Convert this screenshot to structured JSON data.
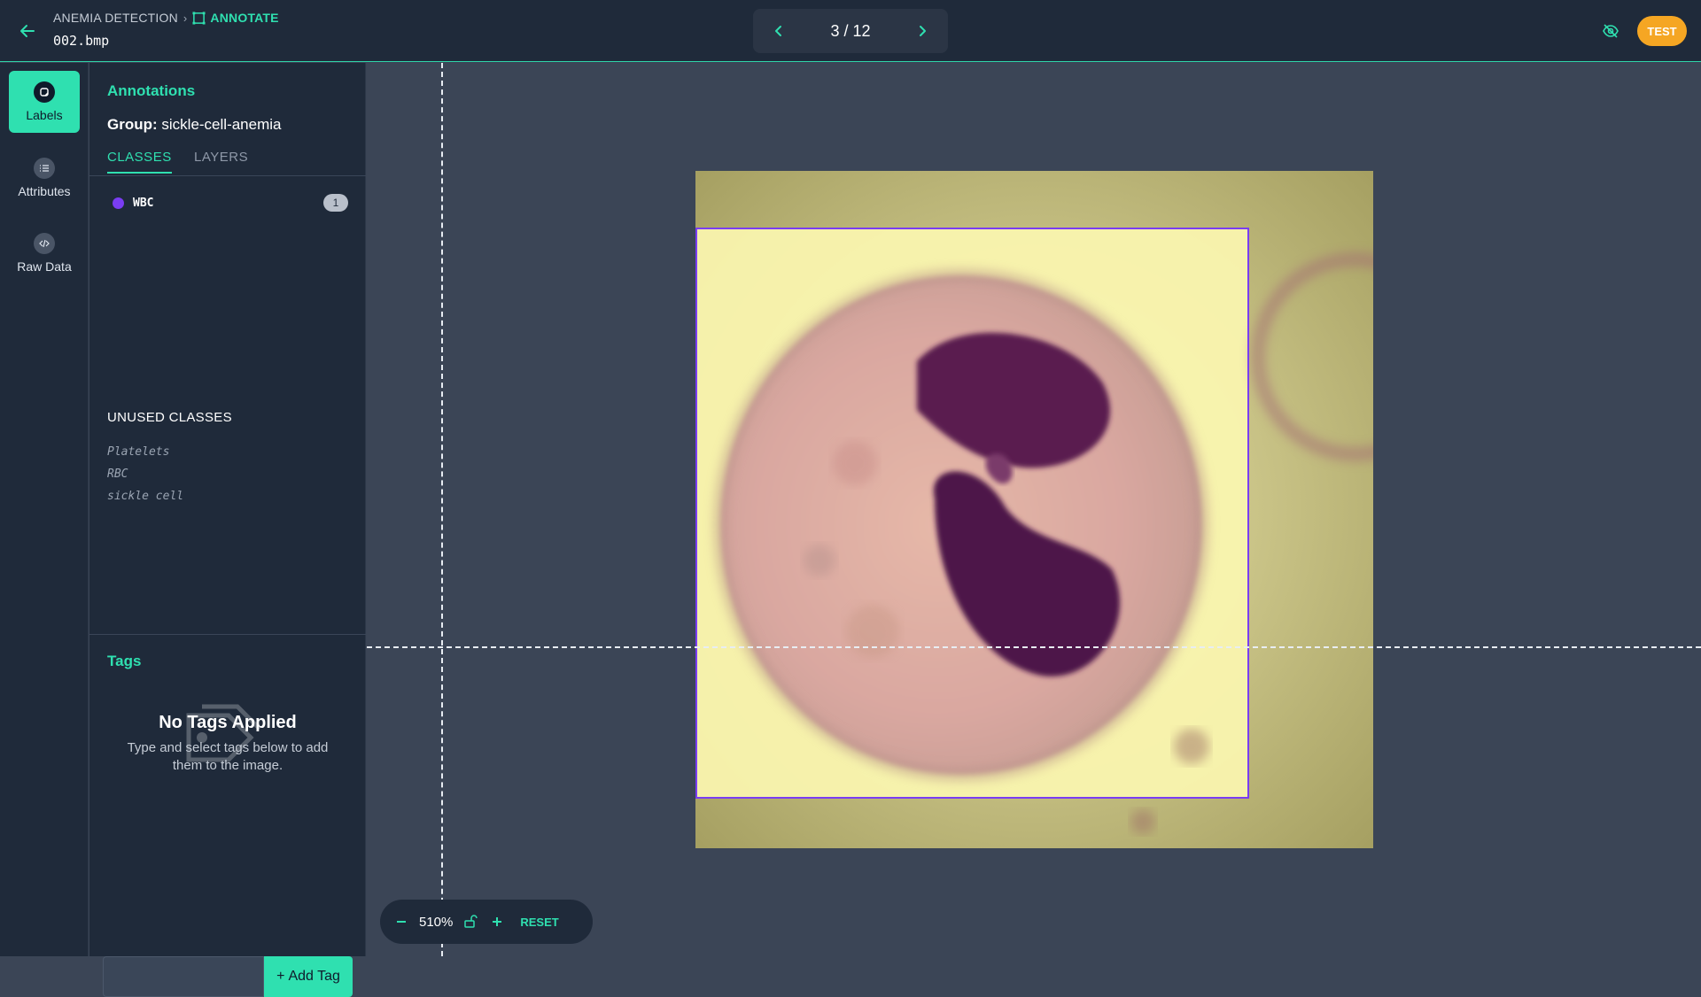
{
  "header": {
    "breadcrumb_project": "ANEMIA DETECTION",
    "breadcrumb_current": "ANNOTATE",
    "filename": "002.bmp",
    "pager_count": "3 / 12",
    "user_initials": "TEST"
  },
  "rail": {
    "items": [
      {
        "label": "Labels",
        "icon": "label-icon",
        "active": true
      },
      {
        "label": "Attributes",
        "icon": "list-icon",
        "active": false
      },
      {
        "label": "Raw Data",
        "icon": "code-icon",
        "active": false
      }
    ]
  },
  "panel": {
    "title": "Annotations",
    "group_label": "Group:",
    "group_value": "sickle-cell-anemia",
    "tabs": [
      "CLASSES",
      "LAYERS"
    ],
    "classes": [
      {
        "name": "WBC",
        "count": "1",
        "color": "#7a3df2"
      }
    ],
    "unused_title": "UNUSED CLASSES",
    "unused": [
      "Platelets",
      "RBC",
      "sickle cell"
    ]
  },
  "tags": {
    "title": "Tags",
    "empty_title": "No Tags Applied",
    "empty_sub": "Type and select tags below to add them to the image.",
    "input_value": "",
    "add_label": "Add Tag"
  },
  "canvas": {
    "zoom": "510%",
    "reset_label": "RESET"
  },
  "colors": {
    "accent": "#2fe0b0",
    "annotation_box": "#7a3df2",
    "user_badge": "#f5a623"
  }
}
